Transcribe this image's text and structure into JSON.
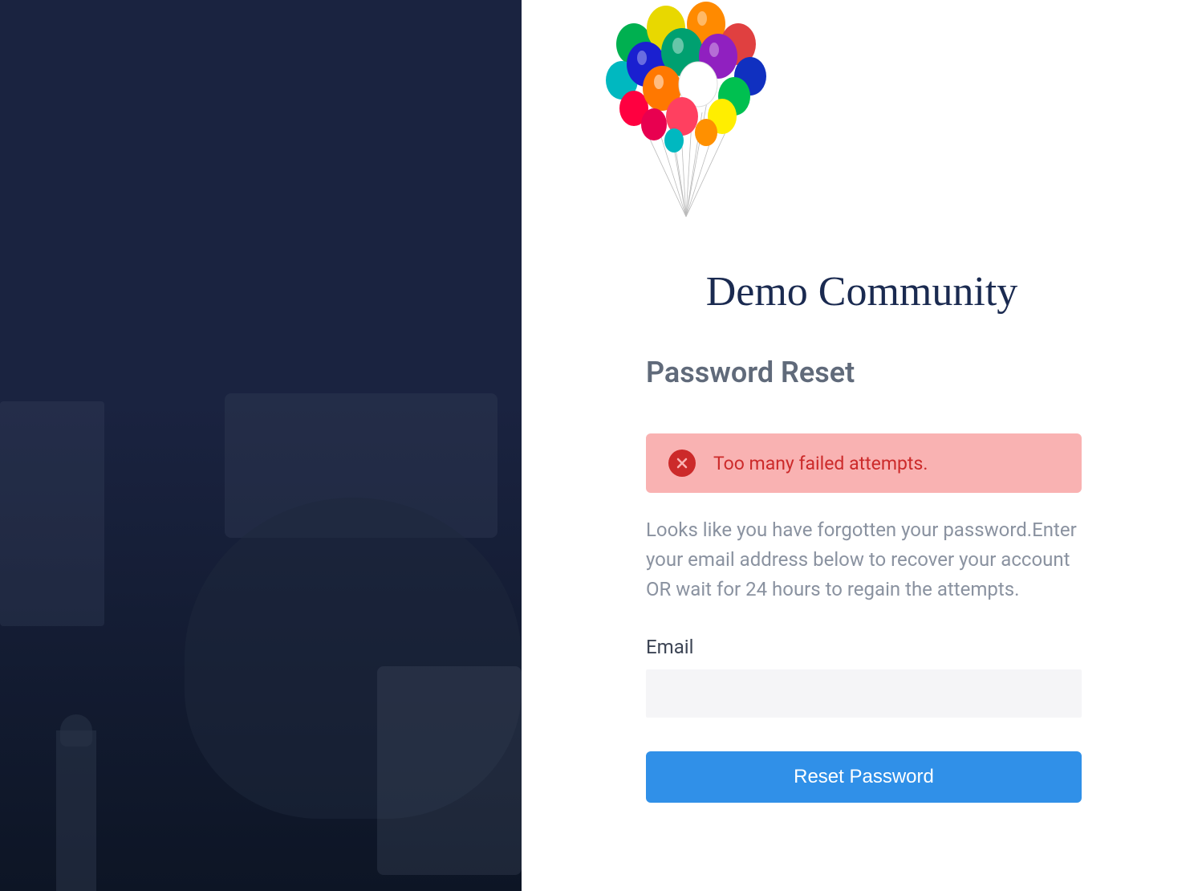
{
  "community": {
    "name": "Demo Community"
  },
  "form": {
    "heading": "Password Reset",
    "error_message": "Too many failed attempts.",
    "description": "Looks like you have forgotten your password.Enter your email address below to recover your account OR wait for 24 hours to regain the attempts.",
    "email_label": "Email",
    "email_value": "",
    "submit_label": "Reset Password"
  },
  "logo": {
    "icon_name": "balloons-icon"
  }
}
